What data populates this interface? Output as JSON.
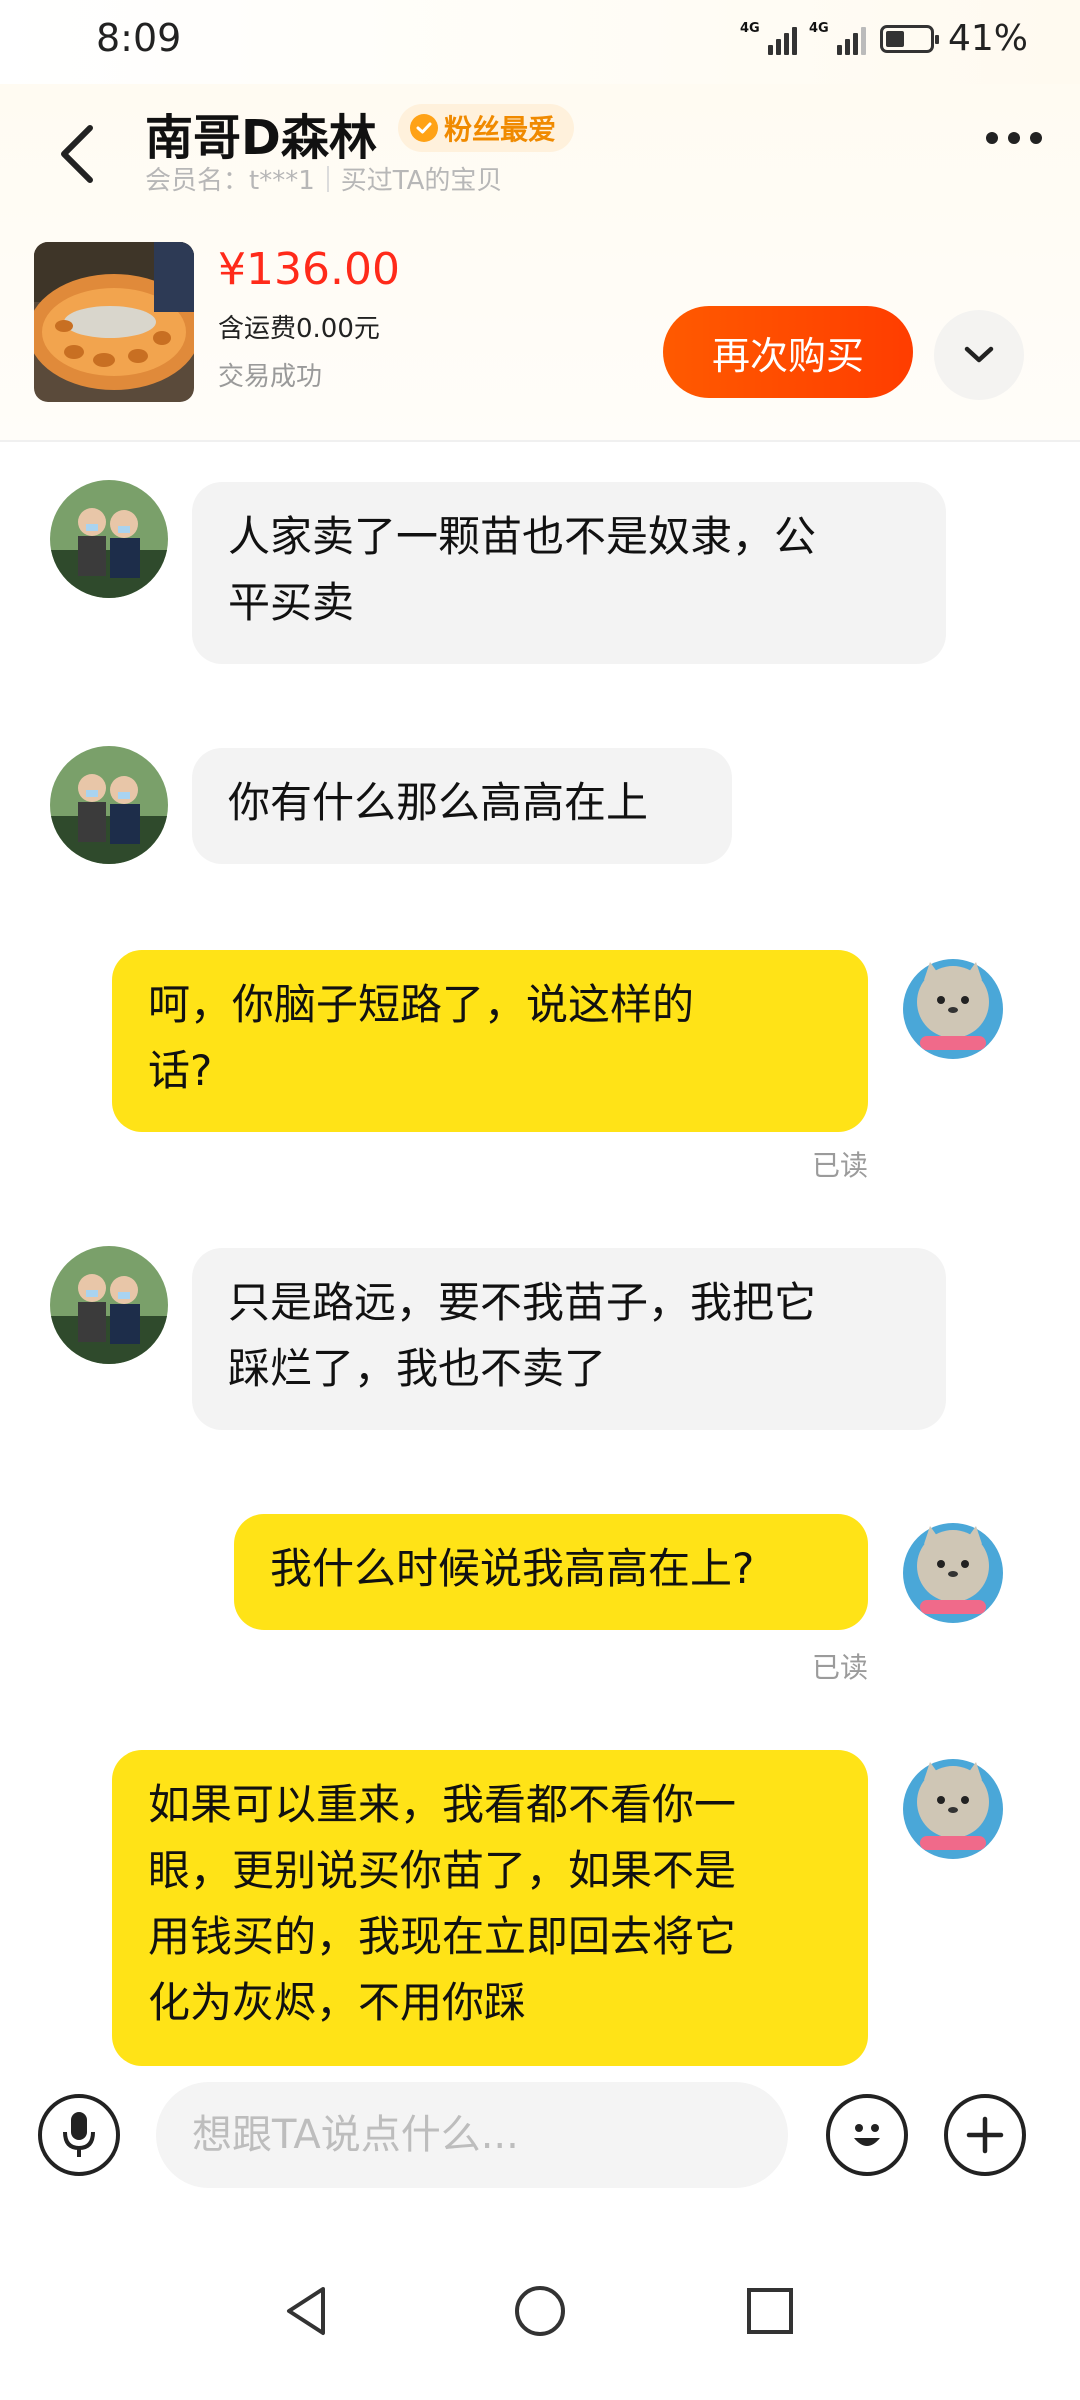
{
  "status_bar": {
    "time": "8:09",
    "net1": "4G",
    "net2": "4G",
    "battery": "41%"
  },
  "header": {
    "title": "南哥D森林",
    "badge": "粉丝最爱",
    "member": "会员名：t***1",
    "bought": "买过TA的宝贝"
  },
  "product": {
    "price": "¥136.00",
    "shipping": "含运费0.00元",
    "status": "交易成功",
    "rebuy_label": "再次购买"
  },
  "messages": [
    {
      "side": "left",
      "lines": [
        "人家卖了一颗苗也不是奴隶，公",
        "平买卖"
      ]
    },
    {
      "side": "left",
      "lines": [
        "你有什么那么高高在上"
      ]
    },
    {
      "side": "right",
      "lines": [
        "呵，你脑子短路了，说这样的",
        "话?"
      ],
      "read": "已读"
    },
    {
      "side": "left",
      "lines": [
        "只是路远，要不我苗子，我把它",
        "踩烂了，我也不卖了"
      ]
    },
    {
      "side": "right",
      "lines": [
        "我什么时候说我高高在上?"
      ],
      "read": "已读"
    },
    {
      "side": "right",
      "lines": [
        "如果可以重来，我看都不看你一",
        "眼，更别说买你苗了，如果不是",
        "用钱买的，我现在立即回去将它",
        "化为灰烬，不用你踩"
      ]
    }
  ],
  "input": {
    "placeholder": "想跟TA说点什么..."
  },
  "colors": {
    "accent": "#ff4a00",
    "bubble_self": "#ffe317",
    "bubble_other": "#f3f3f3",
    "price": "#ff2a1a"
  },
  "icons": {
    "back": "back-arrow-icon",
    "more": "more-dots-icon",
    "expand": "chevron-down-icon",
    "voice": "microphone-icon",
    "emoji": "emoji-icon",
    "plus": "plus-icon"
  }
}
